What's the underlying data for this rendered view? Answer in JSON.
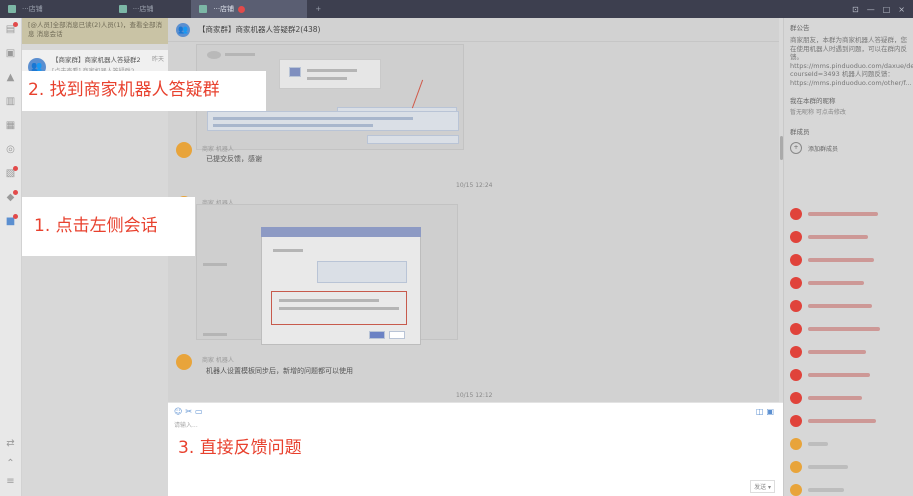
{
  "topbar": {
    "tabs": [
      {
        "label": "···店铺"
      },
      {
        "label": "···店铺"
      },
      {
        "label": "···店铺"
      }
    ],
    "add_tab": "+",
    "window_controls": [
      "⊡",
      "—",
      "□",
      "×"
    ]
  },
  "conversation_list": {
    "notice": "[@人员]全部消息已读(2)人员(1)，查看全部消息 消息会话",
    "items": [
      {
        "name": "【商家群】商家机器人答疑群2",
        "preview": "[点击查看] 商家机器人答疑群2...",
        "time": "昨天"
      }
    ]
  },
  "chat": {
    "title": "【商家群】商家机器人答疑群2(438)",
    "messages": [
      {
        "sender": "商家 机器人",
        "text": "已提交反馈，感谢"
      },
      {
        "sender": "商家 机器人",
        "text": "提醒",
        "time": "10/15 12:24"
      },
      {
        "sender": "商家 机器人",
        "text": "机器人设置模板同步后，新增的问题都可以使用",
        "time": "10/15 12:12"
      }
    ],
    "input_placeholder": "请输入...",
    "send_label": "发送 ▾"
  },
  "callouts": {
    "step1": "1. 点击左侧会话",
    "step2": "2. 找到商家机器人答疑群",
    "step3": "3. 直接反馈问题"
  },
  "right_panel": {
    "announcement_title": "群公告",
    "announcement_text": "商家朋友，本群为商家机器人答疑群，您在使用机器人时遇到问题，可以在群内反馈。https://mms.pinduoduo.com/daxue/detail?courseId=3493 机器人问题反馈：https://mms.pinduoduo.com/other/f...",
    "nickname_title": "我在本群的昵称",
    "nickname_value": "暂无昵称 可点击修改",
    "members_title": "群成员",
    "add_member_label": "添加群成员"
  },
  "colors": {
    "callout_text": "#e8412e",
    "accent_blue": "#5b8fd0",
    "avatar_orange": "#e8a43b",
    "member_red": "#e0433b"
  }
}
